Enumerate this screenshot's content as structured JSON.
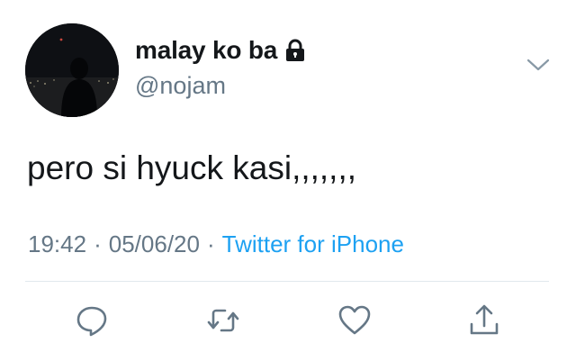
{
  "tweet": {
    "display_name": "malay ko ba",
    "handle": "@nojam",
    "text": "pero si hyuck kasi,,,,,,,",
    "time": "19:42",
    "date": "05/06/20",
    "separator": "·",
    "source": "Twitter for iPhone"
  },
  "icons": {
    "lock": "lock-icon",
    "chevron": "chevron-down-icon",
    "reply": "reply-icon",
    "retweet": "retweet-icon",
    "like": "heart-icon",
    "share": "share-icon"
  },
  "colors": {
    "text": "#14171a",
    "secondary": "#657786",
    "link": "#1da1f2",
    "divider": "#e1e8ed"
  }
}
